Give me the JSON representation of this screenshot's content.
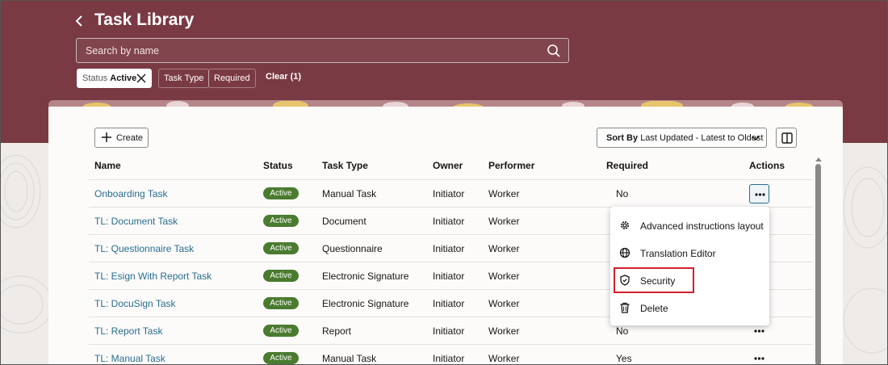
{
  "header": {
    "title": "Task Library",
    "search": {
      "placeholder": "Search by name",
      "value": ""
    }
  },
  "filters": {
    "status": {
      "key": "Status",
      "value": "Active"
    },
    "task_type_label": "Task Type",
    "required_label": "Required",
    "clear_label": "Clear (1)"
  },
  "toolbar": {
    "create_label": "Create",
    "sort_prefix": "Sort By",
    "sort_value": "Last Updated - Latest to Oldest"
  },
  "table": {
    "columns": [
      "Name",
      "Status",
      "Task Type",
      "Owner",
      "Performer",
      "Required",
      "Actions"
    ],
    "rows": [
      {
        "name": "Onboarding Task",
        "status": "Active",
        "task_type": "Manual Task",
        "owner": "Initiator",
        "performer": "Worker",
        "required": "No"
      },
      {
        "name": "TL: Document Task",
        "status": "Active",
        "task_type": "Document",
        "owner": "Initiator",
        "performer": "Worker",
        "required": ""
      },
      {
        "name": "TL: Questionnaire Task",
        "status": "Active",
        "task_type": "Questionnaire",
        "owner": "Initiator",
        "performer": "Worker",
        "required": ""
      },
      {
        "name": "TL: Esign With Report Task",
        "status": "Active",
        "task_type": "Electronic Signature",
        "owner": "Initiator",
        "performer": "Worker",
        "required": ""
      },
      {
        "name": "TL: DocuSign Task",
        "status": "Active",
        "task_type": "Electronic Signature",
        "owner": "Initiator",
        "performer": "Worker",
        "required": ""
      },
      {
        "name": "TL: Report Task",
        "status": "Active",
        "task_type": "Report",
        "owner": "Initiator",
        "performer": "Worker",
        "required": "No"
      },
      {
        "name": "TL: Manual Task",
        "status": "Active",
        "task_type": "Manual Task",
        "owner": "Initiator",
        "performer": "Worker",
        "required": "Yes"
      }
    ]
  },
  "actions_menu": {
    "items": [
      {
        "label": "Advanced instructions layout",
        "icon": "gear-icon"
      },
      {
        "label": "Translation Editor",
        "icon": "globe-icon"
      },
      {
        "label": "Security",
        "icon": "shield-icon"
      },
      {
        "label": "Delete",
        "icon": "trash-icon"
      }
    ],
    "highlighted": "Security"
  },
  "colors": {
    "brand": "#7a3a43",
    "link": "#2a6d8f",
    "active_badge": "#4a7b2f",
    "highlight": "#d21f2c"
  }
}
